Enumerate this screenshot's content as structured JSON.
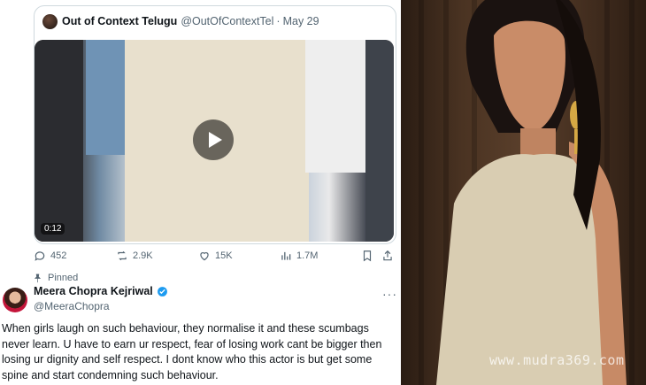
{
  "quoted_tweet": {
    "author_name": "Out of Context Telugu",
    "author_handle": "@OutOfContextTel",
    "separator": "·",
    "date": "May 29",
    "video_duration": "0:12"
  },
  "actions": {
    "replies": "452",
    "retweets": "2.9K",
    "likes": "15K",
    "views": "1.7M"
  },
  "tweet": {
    "pinned_label": "Pinned",
    "author_name": "Meera Chopra Kejriwal",
    "author_handle": "@MeeraChopra",
    "more_label": "···",
    "body": "When girls laugh on such behaviour, they normalise it and these scumbags never learn. U have to earn ur respect, fear of losing work cant be bigger then losing ur dignity and self respect. I dont know who this actor is but get some spine and start condemning such behaviour."
  },
  "photo": {
    "watermark": "www.mudra369.com"
  },
  "colors": {
    "text_primary": "#0f1419",
    "text_secondary": "#536471",
    "border": "#cfd9de",
    "verified_blue": "#1d9bf0"
  }
}
